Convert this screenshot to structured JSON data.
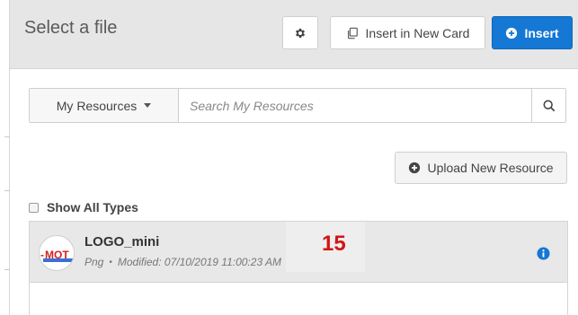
{
  "header": {
    "title": "Select a file",
    "insert_new_card_label": "Insert in New Card",
    "insert_label": "Insert"
  },
  "search": {
    "dropdown_label": "My Resources",
    "placeholder": "Search My Resources",
    "value": ""
  },
  "upload": {
    "label": "Upload New Resource"
  },
  "filters": {
    "show_all_types_label": "Show All Types",
    "show_all_types_checked": false
  },
  "files": [
    {
      "name": "LOGO_mini",
      "type": "Png",
      "modified": "Modified: 07/10/2019 11:00:23 AM",
      "thumbnail_text": "MOT"
    }
  ],
  "annotation": {
    "number": "15"
  },
  "colors": {
    "primary": "#1478d4",
    "header_bg": "#e6e6e6",
    "selected_row_bg": "#e8e8e8",
    "annotation": "#d41414",
    "thumbnail_text": "#d42020",
    "thumbnail_bar": "#3b6fd6"
  },
  "icons": {
    "settings": "gear-icon",
    "new_card": "copy-card-icon",
    "insert": "plus-circle-icon",
    "dropdown": "caret-down-icon",
    "search": "search-icon",
    "upload": "plus-circle-icon",
    "info": "info-icon"
  }
}
